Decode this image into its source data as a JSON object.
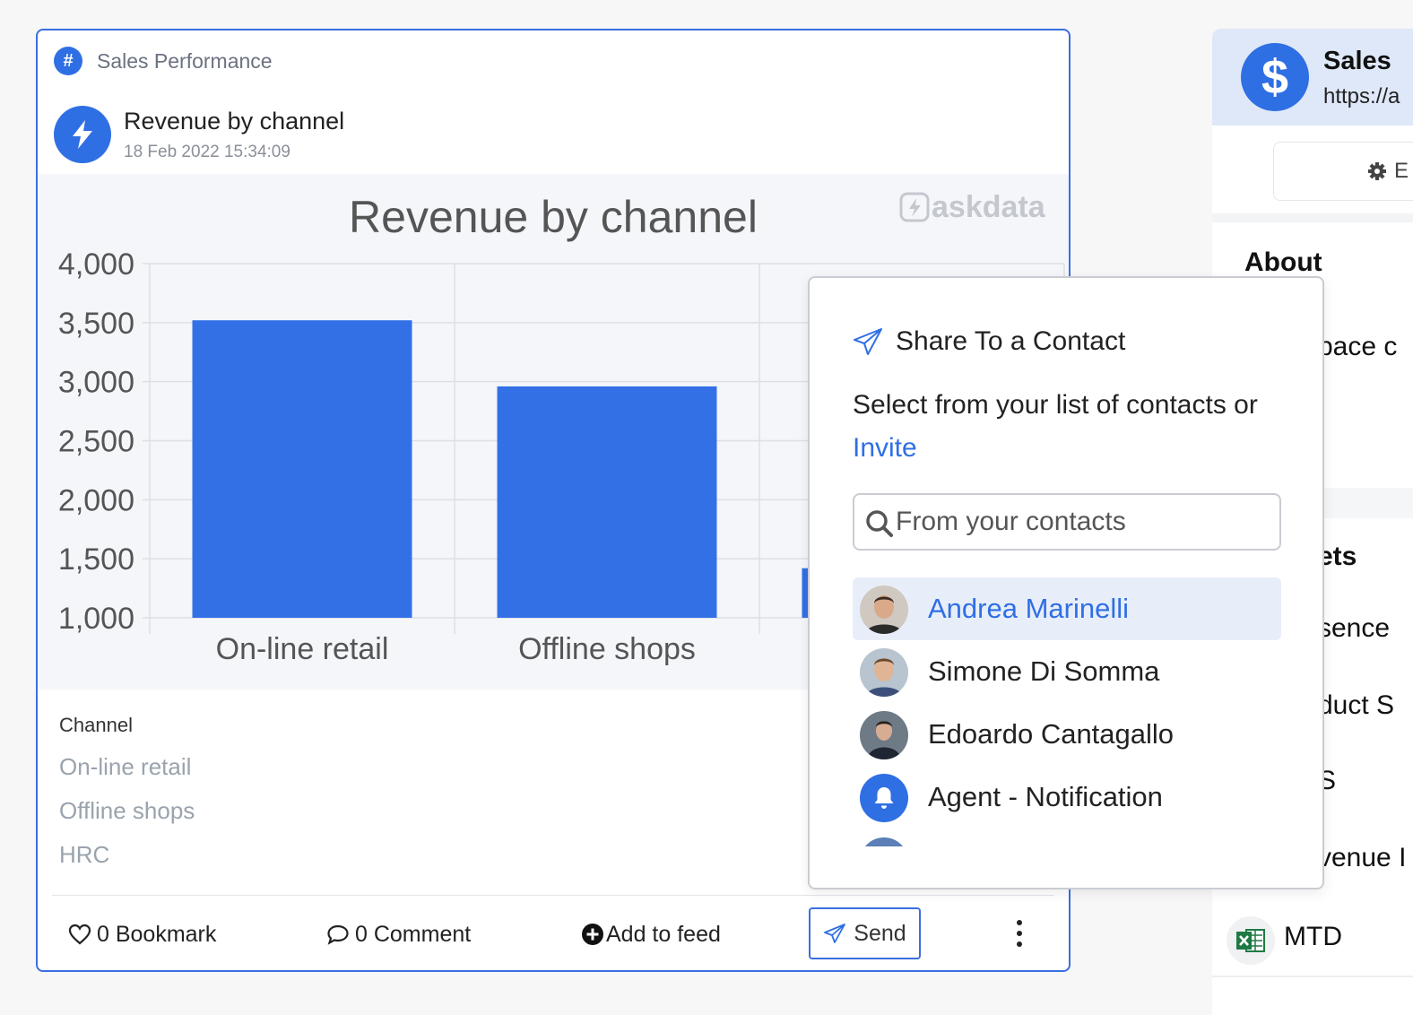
{
  "card": {
    "category": "Sales Performance",
    "title": "Revenue by channel",
    "date": "18 Feb 2022 15:34:09"
  },
  "chart_data": {
    "type": "bar",
    "title": "Revenue by channel",
    "watermark": "askdata",
    "categories": [
      "On-line retail",
      "Offline shops",
      "HRC"
    ],
    "values": [
      3520,
      2960,
      1420
    ],
    "ylim": [
      1000,
      4000
    ],
    "yticks": [
      "4,000",
      "3,500",
      "3,000",
      "2,500",
      "2,000",
      "1,500",
      "1,000"
    ],
    "grid": true,
    "color": "#3370e6"
  },
  "table": {
    "header": "Channel",
    "rows": [
      "On-line retail",
      "Offline shops",
      "HRC"
    ]
  },
  "actions": {
    "bookmark": "0 Bookmark",
    "comment": "0 Comment",
    "add_to_feed": "Add to feed",
    "send": "Send"
  },
  "share": {
    "title": "Share To a Contact",
    "description": "Select from your list of contacts or",
    "invite": "Invite",
    "search_placeholder": "From your contacts",
    "contacts": [
      {
        "name": "Andrea Marinelli"
      },
      {
        "name": "Simone Di Somma"
      },
      {
        "name": "Edoardo Cantagallo"
      },
      {
        "name": "Agent - Notification"
      }
    ]
  },
  "side": {
    "title": "Sales",
    "url": "https://a",
    "button_fragment": "E",
    "about": "About",
    "about_text": "pace c",
    "section": "ets",
    "items": [
      "sence",
      "duct S",
      "S",
      "venue I",
      "MTD"
    ]
  },
  "colors": {
    "accent": "#2f6fe4",
    "bar": "#3370e6"
  }
}
